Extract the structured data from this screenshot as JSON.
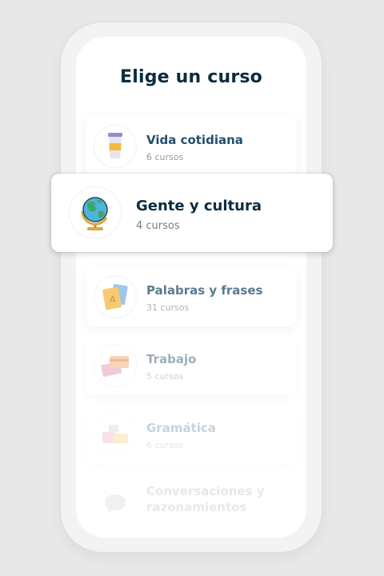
{
  "header": {
    "title": "Elige un curso"
  },
  "courses": [
    {
      "title": "Vida cotidiana",
      "subtitle": "6 cursos",
      "icon": "coffee-cup-icon"
    },
    {
      "title": "Gente y cultura",
      "subtitle": "4 cursos",
      "icon": "globe-icon",
      "selected": true
    },
    {
      "title": "Palabras y frases",
      "subtitle": "31 cursos",
      "icon": "flashcards-icon"
    },
    {
      "title": "Trabajo",
      "subtitle": "5 cursos",
      "icon": "credit-cards-icon"
    },
    {
      "title": "Gramática",
      "subtitle": "6 cursos",
      "icon": "blocks-icon"
    },
    {
      "title": "Conversaciones y razonamientos",
      "subtitle": "",
      "icon": "speech-icon"
    }
  ],
  "colors": {
    "title": "#0d2b3e",
    "card_title": "#24506a",
    "accent_globe": "#3fa66b",
    "accent_ocean": "#4fb4d8"
  }
}
